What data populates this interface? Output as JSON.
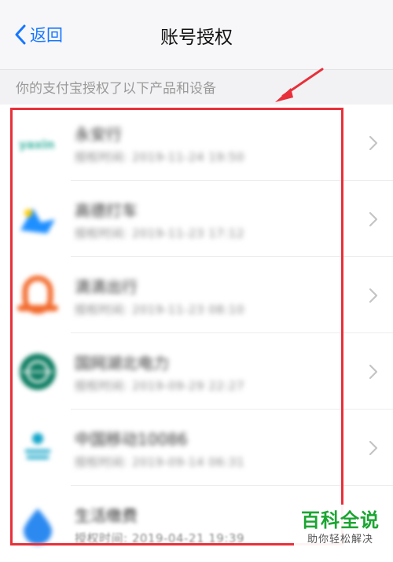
{
  "nav": {
    "back_label": "返回",
    "title": "账号授权"
  },
  "section_label": "你的支付宝授权了以下产品和设备",
  "items": [
    {
      "name": "永安行",
      "time": "授权时间: 2019-11-24 19:50",
      "logo_icon": "yongan-logo-icon",
      "logo_color": "#3bb3a0"
    },
    {
      "name": "高德打车",
      "time": "授权时间: 2019-11-23 17:12",
      "logo_icon": "gaode-logo-icon",
      "logo_color": "#1e8fff"
    },
    {
      "name": "滴滴出行",
      "time": "授权时间: 2019-11-23 08:10",
      "logo_icon": "didi-logo-icon",
      "logo_color": "#f26a2c"
    },
    {
      "name": "国网湖北电力",
      "time": "授权时间: 2019-09-29 22:27",
      "logo_icon": "state-grid-logo-icon",
      "logo_color": "#087a5e"
    },
    {
      "name": "中国移动10086",
      "time": "授权时间: 2019-09-14 06:31",
      "logo_icon": "china-mobile-logo-icon",
      "logo_color": "#11a4c8"
    },
    {
      "name": "生活缴费",
      "time": "授权时间: 2019-04-21 19:39",
      "logo_icon": "life-payment-logo-icon",
      "logo_color": "#2b89f0"
    }
  ],
  "annotation": {
    "box_color": "#e8303a"
  },
  "watermark": {
    "title": "百科全说",
    "subtitle": "助你轻松解决"
  }
}
